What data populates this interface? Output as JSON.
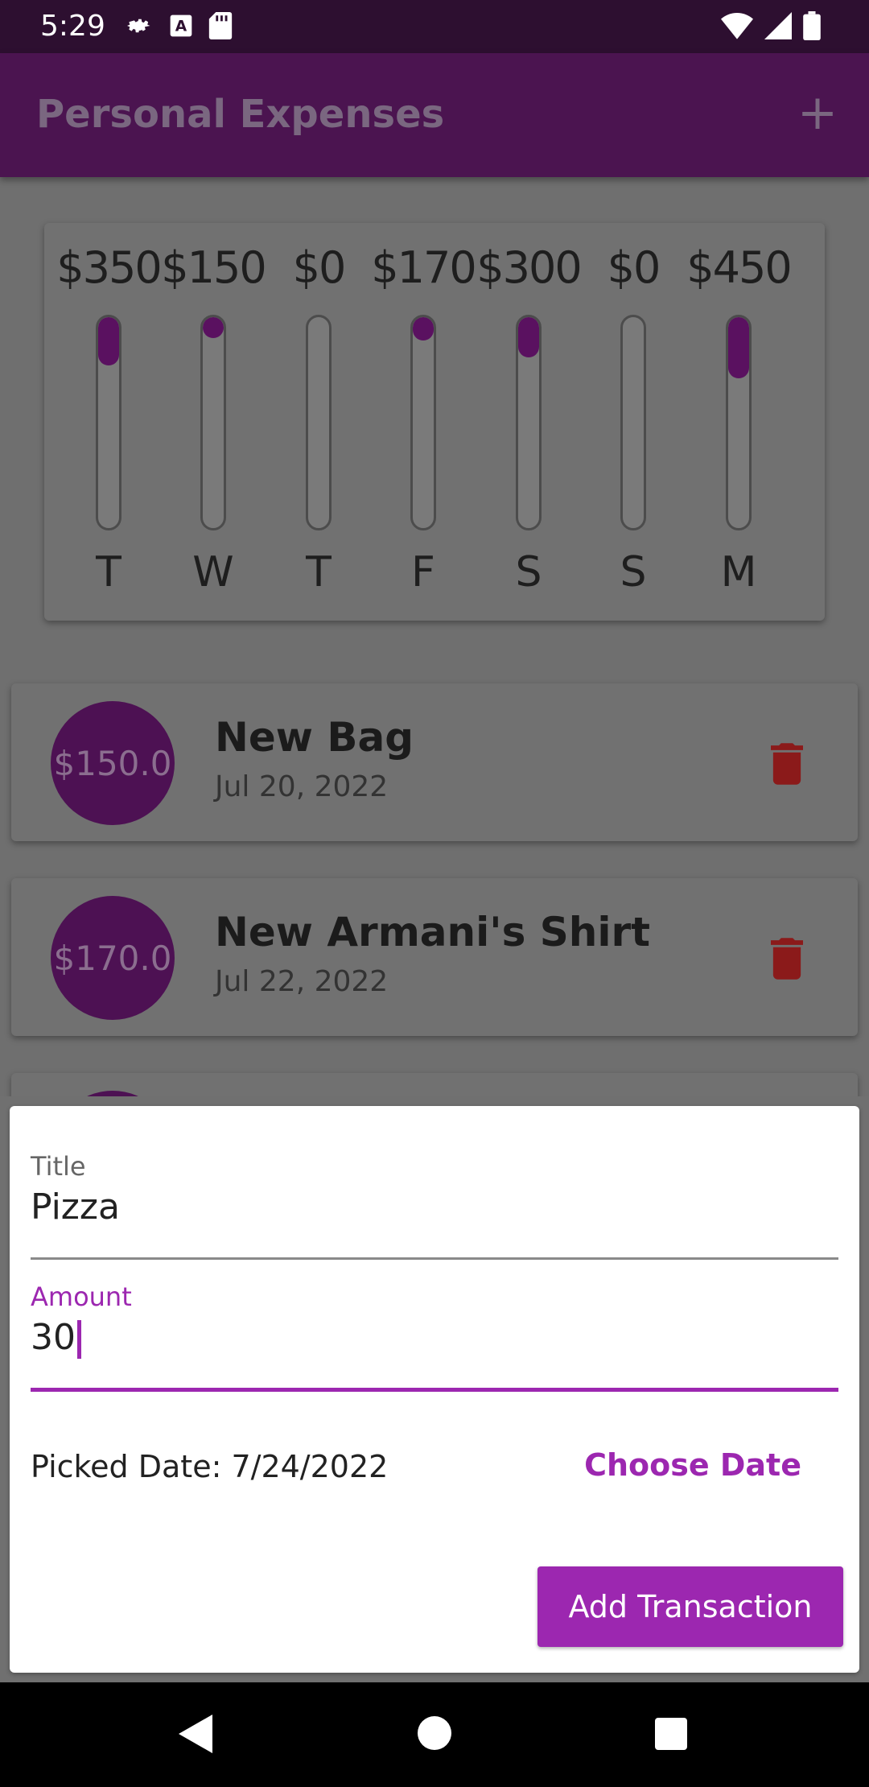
{
  "status": {
    "time": "5:29"
  },
  "app": {
    "title": "Personal Expenses"
  },
  "chart_data": {
    "type": "bar",
    "categories": [
      "T",
      "W",
      "T",
      "F",
      "S",
      "S",
      "M"
    ],
    "value_labels": [
      "$350",
      "$150",
      "$0",
      "$170",
      "$300",
      "$0",
      "$450"
    ],
    "values": [
      350,
      150,
      0,
      170,
      300,
      0,
      450
    ],
    "fill_fraction": [
      0.23,
      0.1,
      0.0,
      0.11,
      0.19,
      0.0,
      0.29
    ]
  },
  "transactions": [
    {
      "amount": "$150.0",
      "title": "New Bag",
      "date": "Jul 20, 2022"
    },
    {
      "amount": "$170.0",
      "title": "New Armani's Shirt",
      "date": "Jul 22, 2022"
    }
  ],
  "form": {
    "title_label": "Title",
    "title_value": "Pizza",
    "amount_label": "Amount",
    "amount_value": "30",
    "picked_date": "Picked Date: 7/24/2022",
    "choose_date_label": "Choose Date",
    "submit_label": "Add Transaction"
  },
  "colors": {
    "primary": "#9c27b0",
    "appbar": "#4b1450",
    "delete": "#8b1a1a"
  }
}
